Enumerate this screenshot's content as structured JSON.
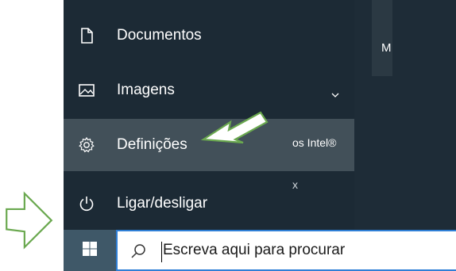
{
  "start_menu": {
    "items": [
      {
        "label": "Documentos",
        "icon": "document-icon"
      },
      {
        "label": "Imagens",
        "icon": "image-icon"
      },
      {
        "label": "Definições",
        "icon": "gear-icon"
      },
      {
        "label": "Ligar/desligar",
        "icon": "power-icon"
      }
    ],
    "tiles": {
      "partial_label_top": "M",
      "partial_label_intel": "os Intel®",
      "partial_label_x": "x"
    }
  },
  "taskbar": {
    "start_icon": "windows-logo-icon",
    "search": {
      "placeholder": "Escreva aqui para procurar",
      "icon": "search-icon"
    }
  },
  "annotations": {
    "arrow_color": "#6aa84f"
  }
}
